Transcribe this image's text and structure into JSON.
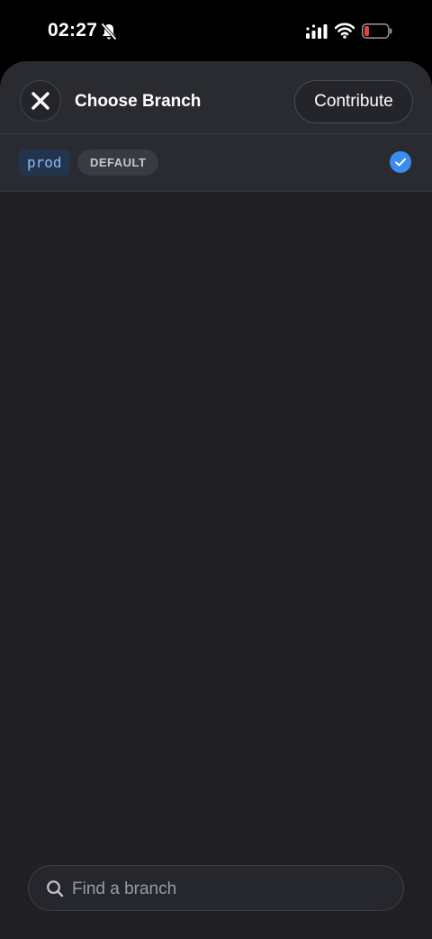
{
  "status_bar": {
    "time": "02:27",
    "icons": [
      "bell-muted-icon",
      "signal-icon",
      "wifi-icon",
      "battery-low-icon"
    ]
  },
  "header": {
    "title": "Choose Branch",
    "close_icon": "close-icon",
    "contribute_label": "Contribute"
  },
  "branches": [
    {
      "name": "prod",
      "badge": "DEFAULT",
      "selected": true
    }
  ],
  "search": {
    "icon": "search-icon",
    "placeholder": "Find a branch",
    "value": ""
  },
  "colors": {
    "sheet_background": "#1f1f24",
    "header_background": "#2a2b31",
    "accent_blue": "#3b8cf0",
    "branch_chip_bg": "#23354d",
    "branch_chip_text": "#8ab8f0",
    "battery_low": "#e5403a"
  }
}
